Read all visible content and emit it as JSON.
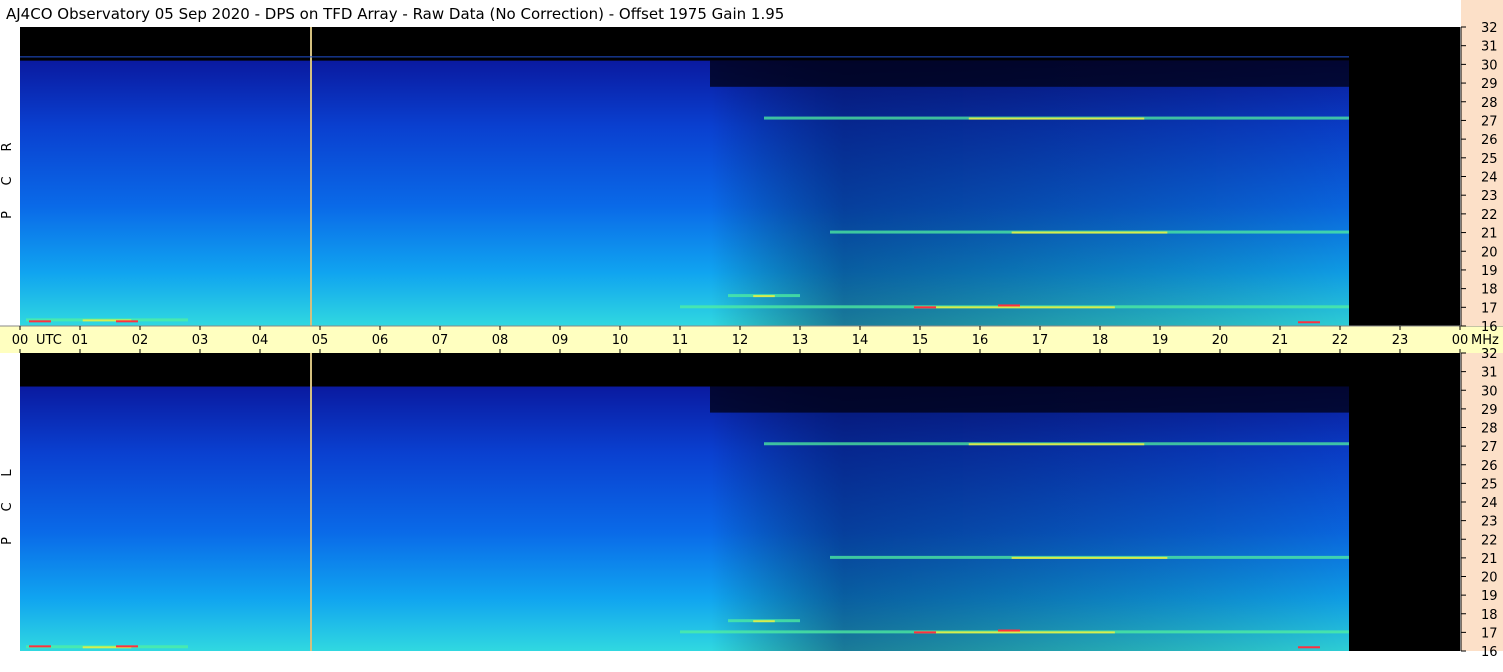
{
  "title": "AJ4CO Observatory  05 Sep 2020  -  DPS on TFD Array  -  Raw Data (No Correction)  -  Offset 1975  Gain 1.95",
  "chart_data": [
    {
      "type": "heatmap",
      "panel": "RCP",
      "polarization_label": [
        "R",
        "C",
        "P"
      ],
      "x_axis": {
        "label": "UTC",
        "range": [
          0,
          24
        ],
        "ticks": [
          "00",
          "01",
          "02",
          "03",
          "04",
          "05",
          "06",
          "07",
          "08",
          "09",
          "10",
          "11",
          "12",
          "13",
          "14",
          "15",
          "16",
          "17",
          "18",
          "19",
          "20",
          "21",
          "22",
          "23",
          "00"
        ]
      },
      "y_axis": {
        "unit": "MHz",
        "range": [
          16,
          32
        ],
        "ticks": [
          "16",
          "17",
          "18",
          "19",
          "20",
          "21",
          "22",
          "23",
          "24",
          "25",
          "26",
          "27",
          "28",
          "29",
          "30",
          "31",
          "32"
        ]
      },
      "data_end_utc": 22.15,
      "features": [
        {
          "kind": "vertical_line",
          "utc": 4.85,
          "color": "#d4c080"
        },
        {
          "kind": "horizontal_band",
          "freq_mhz": 30.4
        },
        {
          "kind": "rfi_band",
          "freq_mhz": 27.1,
          "utc_range": [
            12.4,
            22.15
          ]
        },
        {
          "kind": "rfi_band",
          "freq_mhz": 21.0,
          "utc_range": [
            13.5,
            22.15
          ]
        },
        {
          "kind": "rfi_band",
          "freq_mhz": 17.6,
          "utc_range": [
            11.8,
            13.0
          ]
        },
        {
          "kind": "rfi_band",
          "freq_mhz": 17.0,
          "utc_range": [
            11.0,
            22.15
          ]
        },
        {
          "kind": "rfi_band",
          "freq_mhz": 16.3,
          "utc_range": [
            0.1,
            2.8
          ]
        }
      ]
    },
    {
      "type": "heatmap",
      "panel": "LCP",
      "polarization_label": [
        "L",
        "C",
        "P"
      ],
      "x_axis": {
        "label": "UTC",
        "range": [
          0,
          24
        ]
      },
      "y_axis": {
        "unit": "MHz",
        "range": [
          16,
          32
        ],
        "ticks": [
          "16",
          "17",
          "18",
          "19",
          "20",
          "21",
          "22",
          "23",
          "24",
          "25",
          "26",
          "27",
          "28",
          "29",
          "30",
          "31",
          "32"
        ]
      },
      "data_end_utc": 22.15,
      "features": [
        {
          "kind": "vertical_line",
          "utc": 4.85,
          "color": "#d4c080"
        },
        {
          "kind": "rfi_band",
          "freq_mhz": 27.1,
          "utc_range": [
            12.4,
            22.15
          ]
        },
        {
          "kind": "rfi_band",
          "freq_mhz": 21.0,
          "utc_range": [
            13.5,
            22.15
          ]
        },
        {
          "kind": "rfi_band",
          "freq_mhz": 17.6,
          "utc_range": [
            11.8,
            13.0
          ]
        },
        {
          "kind": "rfi_band",
          "freq_mhz": 17.0,
          "utc_range": [
            11.0,
            22.15
          ]
        },
        {
          "kind": "rfi_band",
          "freq_mhz": 16.2,
          "utc_range": [
            0.1,
            2.8
          ]
        }
      ]
    }
  ],
  "colors": {
    "background_black": "#000000",
    "utc_band": "#ffffc0",
    "freq_axis": "#fce0c8",
    "deep_blue": "#0a1a8c",
    "mid_blue": "#0a5ce0",
    "cyan": "#10c8f0",
    "green": "#50f0a0",
    "rfi_yellow": "#f0f040",
    "rfi_red": "#ff3040"
  }
}
